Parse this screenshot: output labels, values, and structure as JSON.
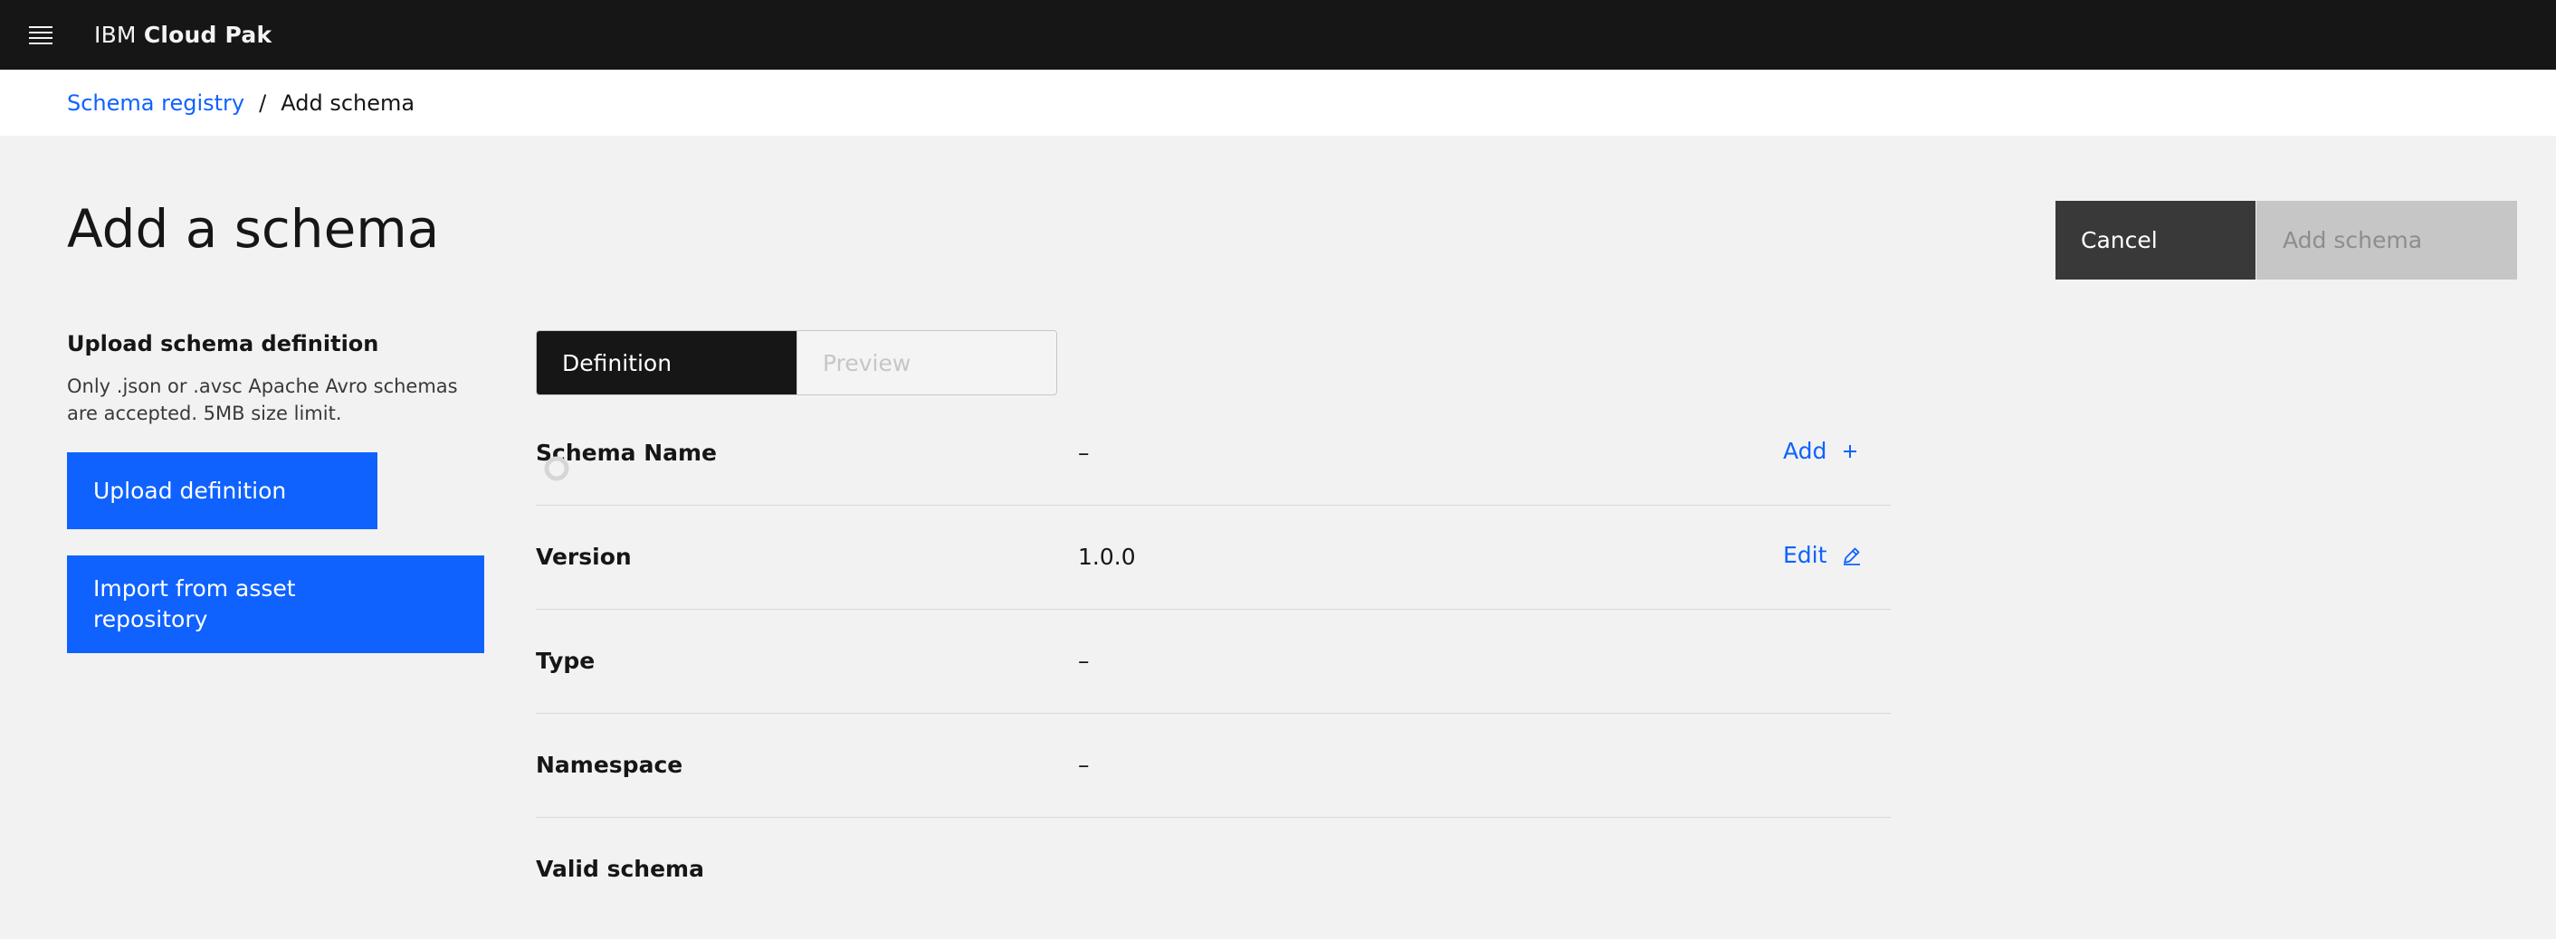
{
  "header": {
    "brand_prefix": "IBM",
    "brand_name": "Cloud Pak"
  },
  "breadcrumb": {
    "parent": "Schema registry",
    "separator": "/",
    "current": "Add schema"
  },
  "page": {
    "title": "Add a schema"
  },
  "actions": {
    "cancel_label": "Cancel",
    "add_label": "Add schema"
  },
  "upload": {
    "heading": "Upload schema definition",
    "help_text": "Only .json or .avsc Apache Avro schemas are accepted. 5MB size limit.",
    "upload_button": "Upload definition",
    "import_button": "Import from asset repository"
  },
  "view_switcher": {
    "tabs": [
      {
        "label": "Definition",
        "selected": true
      },
      {
        "label": "Preview",
        "selected": false
      }
    ]
  },
  "details": {
    "rows": [
      {
        "label": "Schema Name",
        "value": "–",
        "action": "Add"
      },
      {
        "label": "Version",
        "value": "1.0.0",
        "action": "Edit"
      },
      {
        "label": "Type",
        "value": "–"
      },
      {
        "label": "Namespace",
        "value": "–"
      },
      {
        "label": "Valid schema"
      }
    ]
  },
  "colors": {
    "header_bg": "#161616",
    "primary": "#0f62fe",
    "secondary_button": "#393939",
    "disabled_button": "#c6c6c6",
    "page_bg": "#f2f2f2"
  },
  "icons": {
    "menu": "hamburger-menu-icon",
    "add": "plus-icon",
    "edit": "pencil-icon",
    "status": "status-pending-icon"
  }
}
